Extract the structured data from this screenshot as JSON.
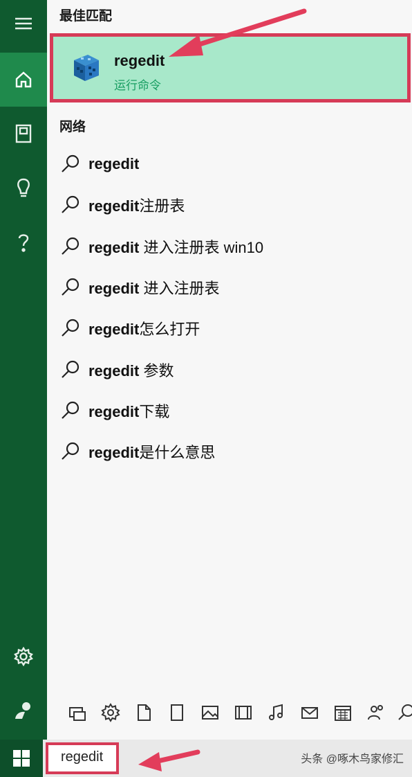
{
  "sections": {
    "best_match": "最佳匹配",
    "web": "网络"
  },
  "best_match": {
    "title": "regedit",
    "subtitle": "运行命令"
  },
  "results": [
    {
      "bold": "regedit",
      "rest": ""
    },
    {
      "bold": "regedit",
      "rest": "注册表"
    },
    {
      "bold": "regedit",
      "rest": " 进入注册表 win10"
    },
    {
      "bold": "regedit",
      "rest": " 进入注册表"
    },
    {
      "bold": "regedit",
      "rest": "怎么打开"
    },
    {
      "bold": "regedit",
      "rest": " 参数"
    },
    {
      "bold": "regedit",
      "rest": "下载"
    },
    {
      "bold": "regedit",
      "rest": "是什么意思"
    }
  ],
  "search": {
    "value": "regedit"
  },
  "watermark": "头条 @啄木鸟家修汇",
  "colors": {
    "sidebar": "#0f5a2f",
    "selected": "#1f8a4c",
    "highlight": "#a8e8ca",
    "annotation": "#d63b57"
  },
  "sidebar_icons": [
    "hamburger-icon",
    "home-icon",
    "notebook-icon",
    "lightbulb-icon",
    "help-icon",
    "settings-icon",
    "feedback-icon"
  ],
  "filter_icons": [
    "apps-icon",
    "settings-icon",
    "document-icon",
    "folder-icon",
    "photo-icon",
    "video-icon",
    "music-icon",
    "mail-icon",
    "calendar-icon",
    "people-icon",
    "web-search-icon"
  ]
}
